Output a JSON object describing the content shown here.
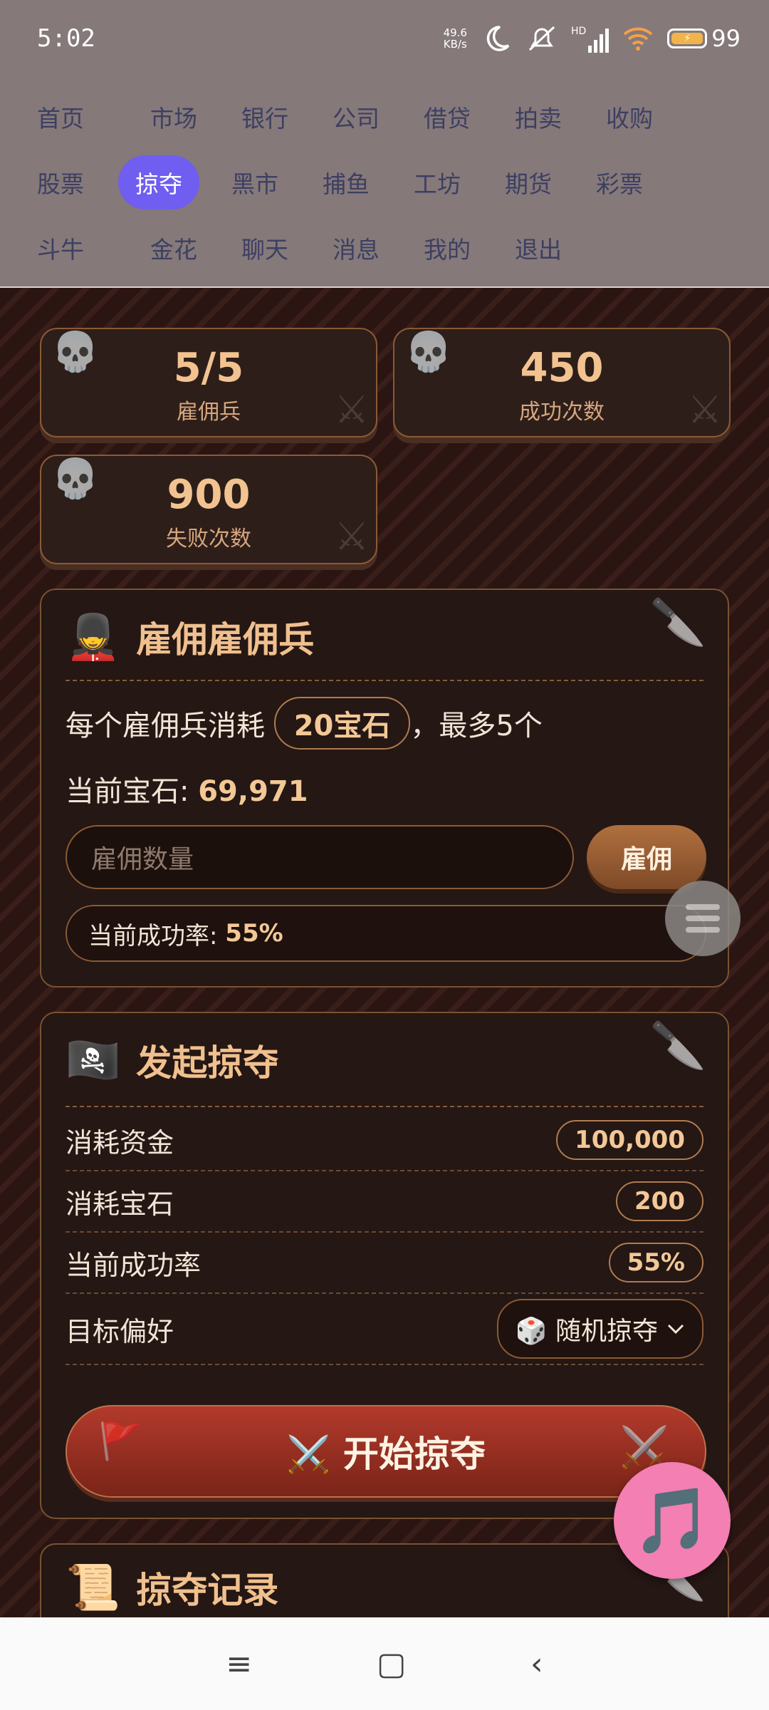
{
  "status": {
    "time": "5:02",
    "net_speed_value": "49.6",
    "net_speed_unit": "KB/s",
    "hd": "HD",
    "battery": "99"
  },
  "nav": {
    "rows": [
      [
        "首页",
        "市场",
        "银行",
        "公司",
        "借贷",
        "拍卖",
        "收购"
      ],
      [
        "股票",
        "掠夺",
        "黑市",
        "捕鱼",
        "工坊",
        "期货",
        "彩票"
      ],
      [
        "斗牛",
        "金花",
        "聊天",
        "消息",
        "我的",
        "退出"
      ]
    ],
    "active": "掠夺"
  },
  "stats": [
    {
      "value": "5/5",
      "label": "雇佣兵"
    },
    {
      "value": "450",
      "label": "成功次数"
    },
    {
      "value": "900",
      "label": "失败次数"
    }
  ],
  "hire": {
    "emoji": "💂",
    "title": "雇佣雇佣兵",
    "cost_prefix": "每个雇佣兵消耗",
    "cost_pill": "20宝石",
    "cost_suffix": "，最多5个",
    "gems_label": "当前宝石: ",
    "gems_value": "69,971",
    "input_placeholder": "雇佣数量",
    "hire_button": "雇佣",
    "rate_label": "当前成功率: ",
    "rate_value": "55%"
  },
  "raid": {
    "emoji": "🏴‍☠️",
    "title": "发起掠夺",
    "rows": [
      {
        "label": "消耗资金",
        "value": "100,000"
      },
      {
        "label": "消耗宝石",
        "value": "200"
      },
      {
        "label": "当前成功率",
        "value": "55%"
      }
    ],
    "target_label": "目标偏好",
    "target_value": "🎲 随机掠夺",
    "start_button": "⚔️ 开始掠夺"
  },
  "records": {
    "emoji": "📜",
    "title": "掠夺记录"
  },
  "bottom_nav": [
    "≡",
    "▢",
    "‹"
  ],
  "icons": {
    "skull": "skull-icon",
    "sword": "crossed-swords-icon",
    "knife": "knife-icon",
    "music": "music-note-icon"
  }
}
